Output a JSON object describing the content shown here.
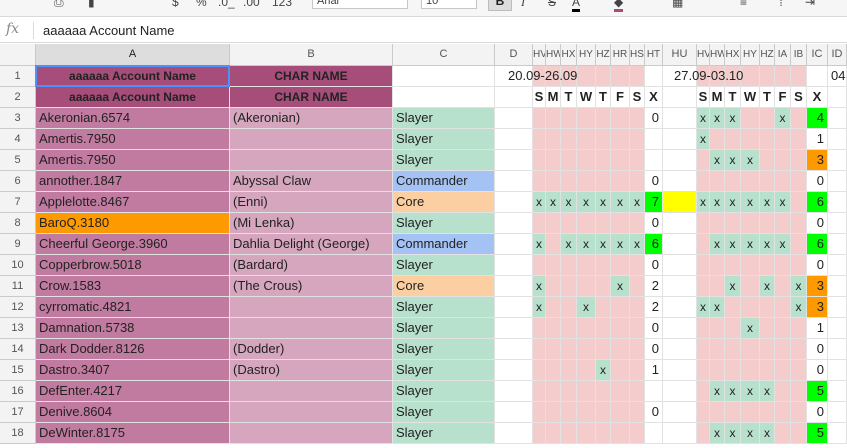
{
  "toolbar": {
    "percent": "%",
    "dec_less": ".0_",
    "dec_more": ".00",
    "format_more": "123",
    "font": "Arial",
    "size": "10",
    "bold": "B",
    "italic": "I",
    "strike": "S",
    "text_color_letter": "A"
  },
  "formula": {
    "fx": "fx",
    "value": "aaaaaa Account Name"
  },
  "cols": [
    "A",
    "B",
    "C",
    "D",
    "HV",
    "HW",
    "HX",
    "HY",
    "HZ",
    "HR",
    "HS",
    "HT",
    "HU",
    "HV",
    "HW",
    "HX",
    "HY",
    "HZ",
    "IA",
    "IB",
    "IC",
    "ID"
  ],
  "colors": {
    "account": "#c27ba0",
    "account_header": "#a64d79",
    "char": "#d5a6bd",
    "slayer": "#b7e1cd",
    "commander": "#a4c2f4",
    "core": "#fbcfa1",
    "absence": "#f4cccc",
    "green": "#00ff00",
    "orange": "#ff9900",
    "yellow": "#ffff00"
  },
  "week1": "20.09-26.09",
  "week2": "27.09-03.10",
  "week3": "04",
  "days": [
    "S",
    "M",
    "T",
    "W",
    "T",
    "F",
    "S",
    "X"
  ],
  "headers": {
    "account": "aaaaaa Account Name",
    "char": "CHAR NAME"
  },
  "rows": [
    {
      "n": "3",
      "account": "Akeronian.6574",
      "char": "(Akeronian)",
      "role": "Slayer",
      "w1": [
        "",
        "",
        "",
        "",
        "",
        "",
        ""
      ],
      "t1": "0",
      "w2": [
        "x",
        "x",
        "x",
        "",
        "",
        "x",
        ""
      ],
      "t2": "4"
    },
    {
      "n": "4",
      "account": "Amertis.7950",
      "char": "",
      "role": "Slayer",
      "w1": [
        "",
        "",
        "",
        "",
        "",
        "",
        ""
      ],
      "t1": "",
      "w2": [
        "x",
        "",
        "",
        "",
        "",
        "",
        ""
      ],
      "t2": "1"
    },
    {
      "n": "5",
      "account": "Amertis.7950",
      "char": "",
      "role": "Slayer",
      "w1": [
        "",
        "",
        "",
        "",
        "",
        "",
        ""
      ],
      "t1": "",
      "w2": [
        "",
        "x",
        "x",
        "x",
        "",
        "",
        ""
      ],
      "t2": "3"
    },
    {
      "n": "6",
      "account": "annother.1847",
      "char": "Abyssal Claw",
      "role": "Commander",
      "w1": [
        "",
        "",
        "",
        "",
        "",
        "",
        ""
      ],
      "t1": "0",
      "w2": [
        "",
        "",
        "",
        "",
        "",
        "",
        ""
      ],
      "t2": "0"
    },
    {
      "n": "7",
      "account": "Applelotte.8467",
      "char": "(Enni)",
      "role": "Core",
      "w1": [
        "x",
        "x",
        "x",
        "x",
        "x",
        "x",
        "x"
      ],
      "t1": "7",
      "w2": [
        "x",
        "x",
        "x",
        "x",
        "x",
        "x",
        ""
      ],
      "t2": "6"
    },
    {
      "n": "8",
      "account": "BaroQ.3180",
      "char": "(Mi Lenka)",
      "role": "Slayer",
      "w1": [
        "",
        "",
        "",
        "",
        "",
        "",
        ""
      ],
      "t1": "0",
      "w2": [
        "",
        "",
        "",
        "",
        "",
        "",
        ""
      ],
      "t2": "0"
    },
    {
      "n": "9",
      "account": "Cheerful George.3960",
      "char": "Dahlia Delight (George)",
      "role": "Commander",
      "w1": [
        "x",
        "",
        "x",
        "x",
        "x",
        "x",
        "x"
      ],
      "t1": "6",
      "w2": [
        "",
        "x",
        "x",
        "x",
        "x",
        "x",
        ""
      ],
      "t2": "6"
    },
    {
      "n": "10",
      "account": "Copperbrow.5018",
      "char": "(Bardard)",
      "role": "Slayer",
      "w1": [
        "",
        "",
        "",
        "",
        "",
        "",
        ""
      ],
      "t1": "0",
      "w2": [
        "",
        "",
        "",
        "",
        "",
        "",
        ""
      ],
      "t2": "0"
    },
    {
      "n": "11",
      "account": "Crow.1583",
      "char": "(The Crous)",
      "role": "Core",
      "w1": [
        "x",
        "",
        "",
        "",
        "",
        "x",
        ""
      ],
      "t1": "2",
      "w2": [
        "",
        "",
        "x",
        "",
        "x",
        "",
        "x"
      ],
      "t2": "3"
    },
    {
      "n": "12",
      "account": "cyrromatic.4821",
      "char": "",
      "role": "Slayer",
      "w1": [
        "x",
        "",
        "",
        "x",
        "",
        "",
        ""
      ],
      "t1": "2",
      "w2": [
        "x",
        "x",
        "",
        "",
        "",
        "",
        "x"
      ],
      "t2": "3"
    },
    {
      "n": "13",
      "account": "Damnation.5738",
      "char": "",
      "role": "Slayer",
      "w1": [
        "",
        "",
        "",
        "",
        "",
        "",
        ""
      ],
      "t1": "0",
      "w2": [
        "",
        "",
        "",
        "x",
        "",
        "",
        ""
      ],
      "t2": "1"
    },
    {
      "n": "14",
      "account": "Dark Dodder.8126",
      "char": "(Dodder)",
      "role": "Slayer",
      "w1": [
        "",
        "",
        "",
        "",
        "",
        "",
        ""
      ],
      "t1": "0",
      "w2": [
        "",
        "",
        "",
        "",
        "",
        "",
        ""
      ],
      "t2": "0"
    },
    {
      "n": "15",
      "account": "Dastro.3407",
      "char": "(Dastro)",
      "role": "Slayer",
      "w1": [
        "",
        "",
        "",
        "",
        "x",
        "",
        ""
      ],
      "t1": "1",
      "w2": [
        "",
        "",
        "",
        "",
        "",
        "",
        ""
      ],
      "t2": "0"
    },
    {
      "n": "16",
      "account": "DefEnter.4217",
      "char": "",
      "role": "Slayer",
      "w1": [
        "",
        "",
        "",
        "",
        "",
        "",
        ""
      ],
      "t1": "",
      "w2": [
        "",
        "x",
        "x",
        "x",
        "x",
        "",
        ""
      ],
      "t2": "5"
    },
    {
      "n": "17",
      "account": "Denive.8604",
      "char": "",
      "role": "Slayer",
      "w1": [
        "",
        "",
        "",
        "",
        "",
        "",
        ""
      ],
      "t1": "0",
      "w2": [
        "",
        "",
        "",
        "",
        "",
        "",
        ""
      ],
      "t2": "0"
    },
    {
      "n": "18",
      "account": "DeWinter.8175",
      "char": "",
      "role": "Slayer",
      "w1": [
        "",
        "",
        "",
        "",
        "",
        "",
        ""
      ],
      "t1": "",
      "w2": [
        "",
        "x",
        "x",
        "x",
        "x",
        "",
        ""
      ],
      "t2": "5"
    }
  ]
}
